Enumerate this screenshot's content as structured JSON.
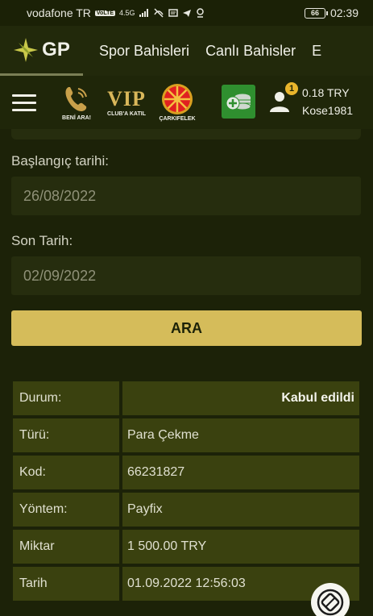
{
  "status_bar": {
    "carrier": "vodafone TR",
    "network": "4.5G",
    "volte": "VoLTE",
    "battery": "66",
    "time": "02:39"
  },
  "header": {
    "logo_text": "GP",
    "nav": [
      "Spor Bahisleri",
      "Canlı Bahisler",
      "E"
    ]
  },
  "toolbar": {
    "promos": [
      {
        "label": "BENİ ARA!",
        "icon": "phone-icon"
      },
      {
        "label": "CLUB'A KATIL",
        "icon": "vip-logo",
        "logo_text": "VIP"
      },
      {
        "label": "ÇARKIFELEK",
        "icon": "wheel-icon"
      }
    ],
    "cashier_icon": "coins-icon",
    "notification_count": "1",
    "balance": "0.18 TRY",
    "username": "Kose1981"
  },
  "form": {
    "start_label": "Başlangıç tarihi:",
    "start_value": "26/08/2022",
    "end_label": "Son Tarih:",
    "end_value": "02/09/2022",
    "search_button": "ARA"
  },
  "details": [
    {
      "key": "Durum:",
      "value": "Kabul edildi"
    },
    {
      "key": "Türü:",
      "value": "Para Çekme"
    },
    {
      "key": "Kod:",
      "value": "66231827"
    },
    {
      "key": "Yöntem:",
      "value": "Payfix"
    },
    {
      "key": "Miktar",
      "value": "1 500.00 TRY"
    },
    {
      "key": "Tarih",
      "value": "01.09.2022 12:56:03"
    }
  ],
  "colors": {
    "background": "#1c2208",
    "accent": "#d5bc5a",
    "table_cell": "#3a410f",
    "cashier": "#2f8f2f"
  }
}
